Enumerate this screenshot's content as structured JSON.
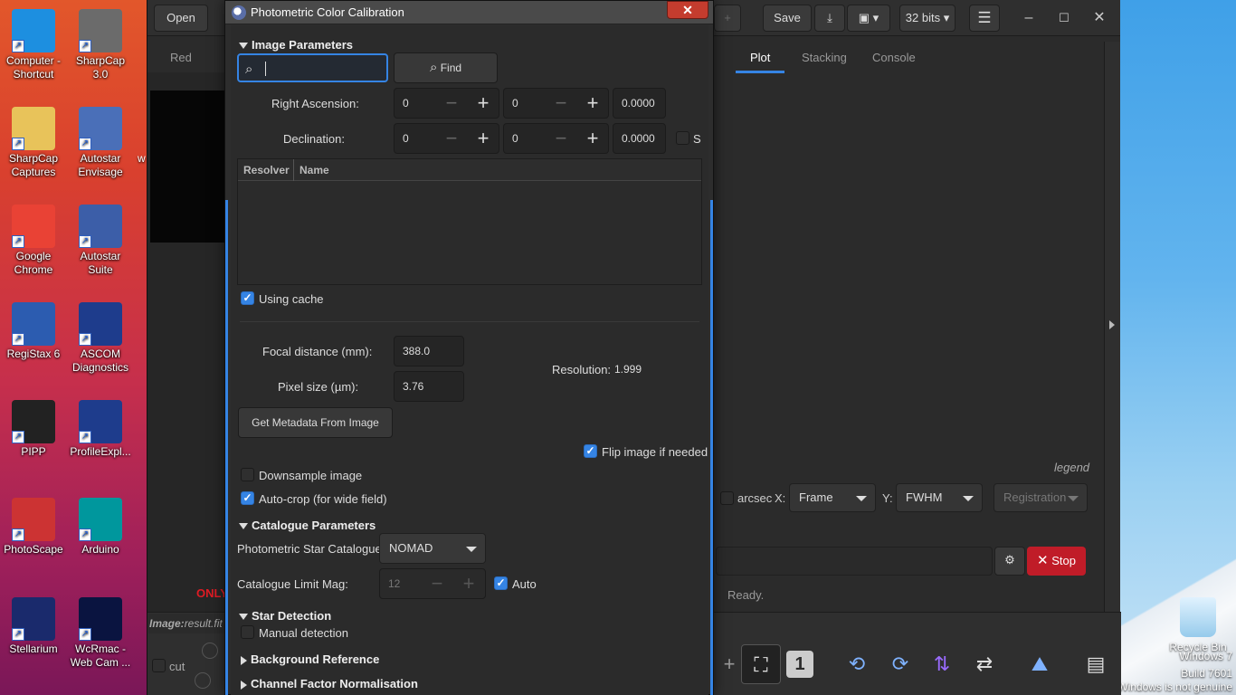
{
  "desktop": {
    "icons": [
      {
        "label": "Computer - Shortcut",
        "color": "#1d8fe0"
      },
      {
        "label": "SharpCap 3.0",
        "color": "#6b6b6b"
      },
      {
        "label": "SharpCap Captures",
        "color": "#e8c35a"
      },
      {
        "label": "Autostar Envisage",
        "color": "#4a6fb8"
      },
      {
        "label": "Google Chrome",
        "color": "#e94235"
      },
      {
        "label": "Autostar Suite",
        "color": "#3c5ea8"
      },
      {
        "label": "RegiStax 6",
        "color": "#2c5cb0"
      },
      {
        "label": "ASCOM Diagnostics",
        "color": "#1e3c8c"
      },
      {
        "label": "PIPP",
        "color": "#222222"
      },
      {
        "label": "ProfileExpl...",
        "color": "#1e3c8c"
      },
      {
        "label": "PhotoScape",
        "color": "#cc3333"
      },
      {
        "label": "Arduino",
        "color": "#00979d"
      },
      {
        "label": "Stellarium",
        "color": "#1a2a6c"
      },
      {
        "label": "WcRmac - Web Cam ...",
        "color": "#0a1440"
      }
    ],
    "recycle_bin": "Recycle Bin",
    "watermark": {
      "line1": "Windows 7",
      "line2": "Build 7601",
      "line3": "Windows is not genuine"
    },
    "partial_w": "w",
    "partial_s": "S"
  },
  "siril": {
    "toolbar": {
      "open": "Open",
      "save": "Save",
      "bits": "32 bits"
    },
    "tabs_left": {
      "red": "Red"
    },
    "tabs_right": {
      "plot": "Plot",
      "stacking": "Stacking",
      "console": "Console"
    },
    "legend": "legend",
    "plot_controls": {
      "arcsec": "arcsec",
      "x_label": "X:",
      "x_value": "Frame",
      "y_label": "Y:",
      "y_value": "FWHM",
      "registration": "Registration"
    },
    "stop": "Stop",
    "status": "Ready.",
    "only_label": "ONLY",
    "image_label": "Image:",
    "image_file": "result.fit",
    "cut_label": "cut",
    "bottom_one": "1"
  },
  "dialog": {
    "title": "Photometric Color Calibration",
    "close": "✕",
    "image_params": {
      "header": "Image Parameters",
      "search_value": "",
      "find": "Find",
      "ra_label": "Right Ascension:",
      "ra": [
        "0",
        "0",
        "0.0000"
      ],
      "dec_label": "Declination:",
      "dec": [
        "0",
        "0",
        "0.0000"
      ],
      "south_label": "S",
      "table_cols": [
        "Resolver",
        "Name"
      ],
      "using_cache": "Using cache",
      "focal_label": "Focal distance (mm):",
      "focal_value": "388.0",
      "pixel_label": "Pixel size (µm):",
      "pixel_value": "3.76",
      "resolution_label": "Resolution:",
      "resolution_value": "1.999",
      "get_metadata": "Get Metadata From Image",
      "flip": "Flip image if needed",
      "downsample": "Downsample image",
      "autocrop": "Auto-crop (for wide field)"
    },
    "catalogue": {
      "header": "Catalogue Parameters",
      "star_cat_label": "Photometric Star Catalogue:",
      "star_cat_value": "NOMAD",
      "limit_label": "Catalogue Limit Mag:",
      "limit_value": "12",
      "auto": "Auto"
    },
    "star_detection": {
      "header": "Star Detection",
      "manual": "Manual detection"
    },
    "background": {
      "header": "Background Reference"
    },
    "channel": {
      "header": "Channel Factor Normalisation"
    }
  }
}
